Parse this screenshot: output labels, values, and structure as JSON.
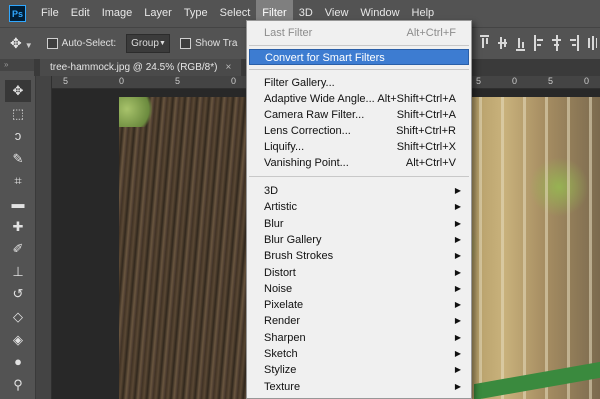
{
  "menubar": {
    "logo": "Ps",
    "items": [
      {
        "label": "File"
      },
      {
        "label": "Edit"
      },
      {
        "label": "Image"
      },
      {
        "label": "Layer"
      },
      {
        "label": "Type"
      },
      {
        "label": "Select"
      },
      {
        "label": "Filter",
        "active": true
      },
      {
        "label": "3D"
      },
      {
        "label": "View"
      },
      {
        "label": "Window"
      },
      {
        "label": "Help"
      }
    ]
  },
  "options": {
    "auto_select_label": "Auto-Select:",
    "auto_select_value": "Group",
    "show_transform_label": "Show Tra"
  },
  "document": {
    "tab_title": "tree-hammock.jpg @ 24.5% (RGB/8*)",
    "close": "×"
  },
  "ruler": {
    "numbers": [
      "5",
      "0",
      "5",
      "0",
      "5",
      "0",
      "5",
      "0"
    ]
  },
  "filter_menu": {
    "last_filter": {
      "label": "Last Filter",
      "shortcut": "Alt+Ctrl+F"
    },
    "convert": {
      "label": "Convert for Smart Filters"
    },
    "group1": [
      {
        "label": "Filter Gallery...",
        "shortcut": ""
      },
      {
        "label": "Adaptive Wide Angle...",
        "shortcut": "Alt+Shift+Ctrl+A"
      },
      {
        "label": "Camera Raw Filter...",
        "shortcut": "Shift+Ctrl+A"
      },
      {
        "label": "Lens Correction...",
        "shortcut": "Shift+Ctrl+R"
      },
      {
        "label": "Liquify...",
        "shortcut": "Shift+Ctrl+X"
      },
      {
        "label": "Vanishing Point...",
        "shortcut": "Alt+Ctrl+V"
      }
    ],
    "submenus": [
      {
        "label": "3D"
      },
      {
        "label": "Artistic"
      },
      {
        "label": "Blur"
      },
      {
        "label": "Blur Gallery"
      },
      {
        "label": "Brush Strokes"
      },
      {
        "label": "Distort"
      },
      {
        "label": "Noise"
      },
      {
        "label": "Pixelate"
      },
      {
        "label": "Render"
      },
      {
        "label": "Sharpen"
      },
      {
        "label": "Sketch"
      },
      {
        "label": "Stylize"
      },
      {
        "label": "Texture"
      }
    ],
    "submenu_arrow": "▶"
  },
  "tools": [
    {
      "name": "move-tool-icon",
      "glyph": "✥"
    },
    {
      "name": "marquee-tool-icon",
      "glyph": "⬚"
    },
    {
      "name": "lasso-tool-icon",
      "glyph": "ↄ"
    },
    {
      "name": "quick-select-tool-icon",
      "glyph": "✎"
    },
    {
      "name": "crop-tool-icon",
      "glyph": "⌗"
    },
    {
      "name": "ruler-tool-icon",
      "glyph": "▬"
    },
    {
      "name": "healing-brush-tool-icon",
      "glyph": "✚"
    },
    {
      "name": "brush-tool-icon",
      "glyph": "✐"
    },
    {
      "name": "clone-stamp-tool-icon",
      "glyph": "⊥"
    },
    {
      "name": "history-brush-tool-icon",
      "glyph": "↺"
    },
    {
      "name": "eraser-tool-icon",
      "glyph": "◇"
    },
    {
      "name": "paint-bucket-tool-icon",
      "glyph": "◈"
    },
    {
      "name": "blur-tool-icon",
      "glyph": "●"
    },
    {
      "name": "dodge-tool-icon",
      "glyph": "⚲"
    }
  ]
}
